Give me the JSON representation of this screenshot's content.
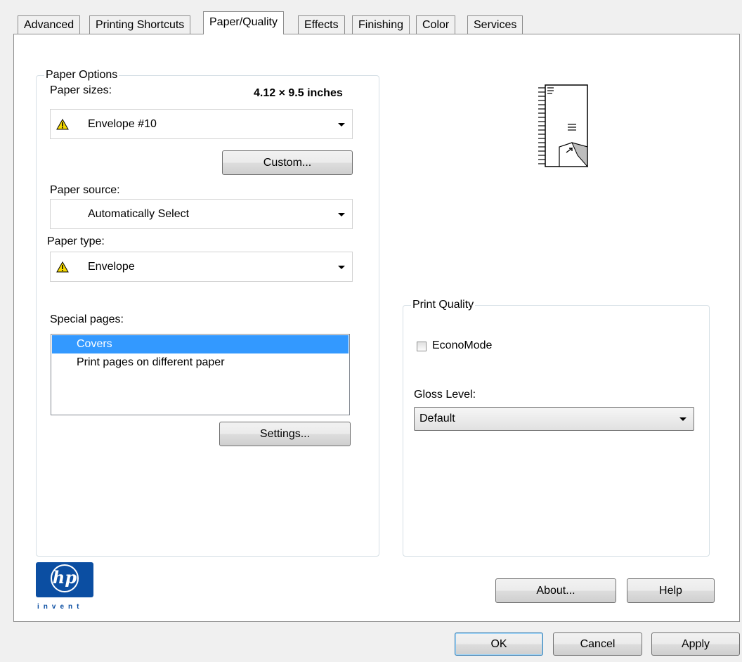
{
  "tabs": [
    {
      "label": "Advanced"
    },
    {
      "label": "Printing Shortcuts"
    },
    {
      "label": "Paper/Quality",
      "active": true
    },
    {
      "label": "Effects"
    },
    {
      "label": "Finishing"
    },
    {
      "label": "Color"
    },
    {
      "label": "Services"
    }
  ],
  "paper_options": {
    "legend": "Paper Options",
    "sizes_label": "Paper sizes:",
    "size_dimensions": "4.12 × 9.5 inches",
    "size_value": "Envelope #10",
    "custom_button": "Custom...",
    "source_label": "Paper source:",
    "source_value": "Automatically Select",
    "type_label": "Paper type:",
    "type_value": "Envelope",
    "special_pages_label": "Special pages:",
    "special_pages": [
      "Covers",
      "Print pages on different paper"
    ],
    "selected_special_page": "Covers",
    "settings_button": "Settings..."
  },
  "print_quality": {
    "legend": "Print Quality",
    "econo_mode_label": "EconoMode",
    "econo_mode_checked": false,
    "gloss_label": "Gloss Level:",
    "gloss_value": "Default"
  },
  "logo": {
    "brand": "hp",
    "tagline": "invent"
  },
  "buttons": {
    "about": "About...",
    "help": "Help",
    "ok": "OK",
    "cancel": "Cancel",
    "apply": "Apply"
  },
  "colors": {
    "selection": "#3399ff",
    "hp_blue": "#0b4ea2",
    "warning": "#f5d800"
  }
}
